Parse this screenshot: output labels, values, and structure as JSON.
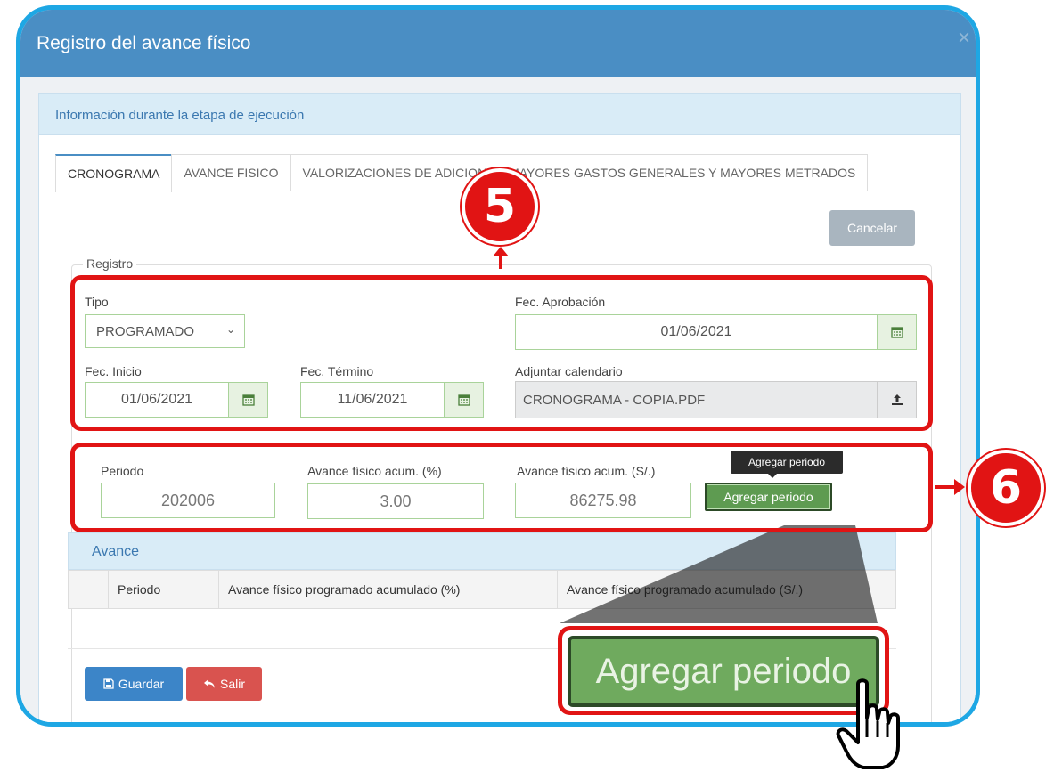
{
  "dialog": {
    "title": "Registro del avance físico",
    "close_glyph": "×"
  },
  "panel": {
    "heading": "Información durante la etapa de ejecución"
  },
  "tabs": [
    {
      "label": "CRONOGRAMA",
      "active": true
    },
    {
      "label": "AVANCE FISICO",
      "active": false
    },
    {
      "label": "VALORIZACIONES DE ADICIONAL, MAYORES GASTOS GENERALES Y MAYORES METRADOS",
      "active": false
    }
  ],
  "actions": {
    "cancel_label": "Cancelar",
    "save_label": "Guardar",
    "exit_label": "Salir"
  },
  "registro": {
    "legend": "Registro",
    "tipo_label": "Tipo",
    "tipo_value": "PROGRAMADO",
    "fec_aprobacion_label": "Fec. Aprobación",
    "fec_aprobacion_value": "01/06/2021",
    "fec_inicio_label": "Fec. Inicio",
    "fec_inicio_value": "01/06/2021",
    "fec_termino_label": "Fec. Término",
    "fec_termino_value": "11/06/2021",
    "adjuntar_label": "Adjuntar calendario",
    "adjuntar_value": "CRONOGRAMA - COPIA.PDF"
  },
  "periodo": {
    "periodo_label": "Periodo",
    "periodo_value": "202006",
    "avance_pct_label": "Avance físico acum. (%)",
    "avance_pct_value": "3.00",
    "avance_soles_label": "Avance físico acum. (S/.)",
    "avance_soles_value": "86275.98",
    "add_button_label": "Agregar periodo",
    "tooltip": "Agregar periodo"
  },
  "avance_table": {
    "heading": "Avance",
    "columns": [
      "Periodo",
      "Avance físico programado acumulado (%)",
      "Avance físico programado acumulado (S/.)"
    ]
  },
  "annotations": {
    "step_5": "5",
    "step_6": "6",
    "zoom_label": "Agregar periodo"
  },
  "colors": {
    "frame_border": "#1ea7e4",
    "titlebar": "#4a8ec4",
    "annotation_red": "#e11414",
    "input_border_green": "#a9d39a",
    "add_button_green": "#5e9b51",
    "save_blue": "#3c85c8",
    "exit_red": "#d9534f"
  },
  "icons": {
    "calendar": "calendar-icon",
    "upload": "upload-icon",
    "save": "floppy-icon",
    "exit": "reply-icon",
    "pointer": "hand-pointer-icon"
  }
}
